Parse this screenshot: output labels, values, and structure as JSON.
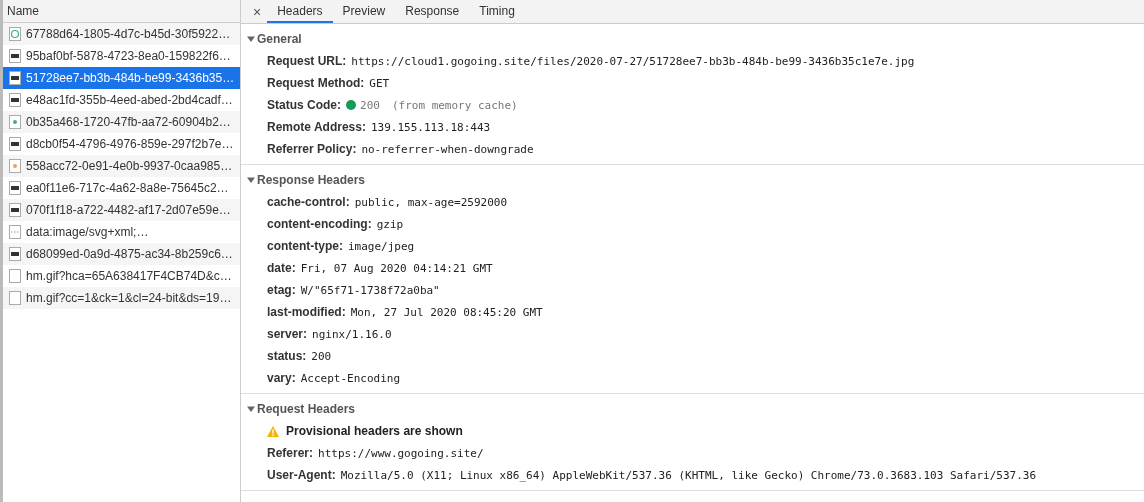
{
  "list_header": "Name",
  "requests": [
    {
      "name": "67788d64-1805-4d7c-b45d-30f5922…",
      "kind": "font",
      "selected": false
    },
    {
      "name": "95baf0bf-5878-4723-8ea0-159822f6…",
      "kind": "image",
      "selected": false
    },
    {
      "name": "51728ee7-bb3b-484b-be99-3436b35…",
      "kind": "image",
      "selected": true
    },
    {
      "name": "e48ac1fd-355b-4eed-abed-2bd4cadf…",
      "kind": "image",
      "selected": false
    },
    {
      "name": "0b35a468-1720-47fb-aa72-60904b2…",
      "kind": "dot",
      "selected": false
    },
    {
      "name": "d8cb0f54-4796-4976-859e-297f2b7e…",
      "kind": "image",
      "selected": false
    },
    {
      "name": "558acc72-0e91-4e0b-9937-0caa985…",
      "kind": "sun",
      "selected": false
    },
    {
      "name": "ea0f11e6-717c-4a62-8a8e-75645c2…",
      "kind": "image",
      "selected": false
    },
    {
      "name": "070f1f18-a722-4482-af17-2d07e59e…",
      "kind": "image",
      "selected": false
    },
    {
      "name": "data:image/svg+xml;…",
      "kind": "svg",
      "selected": false
    },
    {
      "name": "d68099ed-0a9d-4875-ac34-8b259c6…",
      "kind": "image",
      "selected": false
    },
    {
      "name": "hm.gif?hca=65A638417F4CB74D&c…",
      "kind": "blank",
      "selected": false
    },
    {
      "name": "hm.gif?cc=1&ck=1&cl=24-bit&ds=19…",
      "kind": "blank",
      "selected": false
    }
  ],
  "close": "×",
  "tabs": [
    {
      "label": "Headers",
      "selected": true
    },
    {
      "label": "Preview",
      "selected": false
    },
    {
      "label": "Response",
      "selected": false
    },
    {
      "label": "Timing",
      "selected": false
    }
  ],
  "sections": [
    {
      "title": "General",
      "expanded": true,
      "rows": [
        {
          "key": "Request URL:",
          "value": "https://cloud1.gogoing.site/files/2020-07-27/51728ee7-bb3b-484b-be99-3436b35c1e7e.jpg"
        },
        {
          "key": "Request Method:",
          "value": "GET"
        },
        {
          "key": "Status Code:",
          "value": "200",
          "note": "(from memory cache)",
          "color": "#0f9d58"
        },
        {
          "key": "Remote Address:",
          "value": "139.155.113.18:443"
        },
        {
          "key": "Referrer Policy:",
          "value": "no-referrer-when-downgrade"
        }
      ]
    },
    {
      "title": "Response Headers",
      "expanded": true,
      "rows": [
        {
          "key": "cache-control:",
          "value": "public, max-age=2592000"
        },
        {
          "key": "content-encoding:",
          "value": "gzip"
        },
        {
          "key": "content-type:",
          "value": "image/jpeg"
        },
        {
          "key": "date:",
          "value": "Fri, 07 Aug 2020 04:14:21 GMT"
        },
        {
          "key": "etag:",
          "value": "W/\"65f71-1738f72a0ba\""
        },
        {
          "key": "last-modified:",
          "value": "Mon, 27 Jul 2020 08:45:20 GMT"
        },
        {
          "key": "server:",
          "value": "nginx/1.16.0"
        },
        {
          "key": "status:",
          "value": "200"
        },
        {
          "key": "vary:",
          "value": "Accept-Encoding"
        }
      ]
    },
    {
      "title": "Request Headers",
      "expanded": true,
      "warning": "Provisional headers are shown",
      "rows": [
        {
          "key": "Referer:",
          "value": "https://www.gogoing.site/"
        },
        {
          "key": "User-Agent:",
          "value": "Mozilla/5.0 (X11; Linux x86_64) AppleWebKit/537.36 (KHTML, like Gecko) Chrome/73.0.3683.103 Safari/537.36"
        }
      ]
    }
  ]
}
